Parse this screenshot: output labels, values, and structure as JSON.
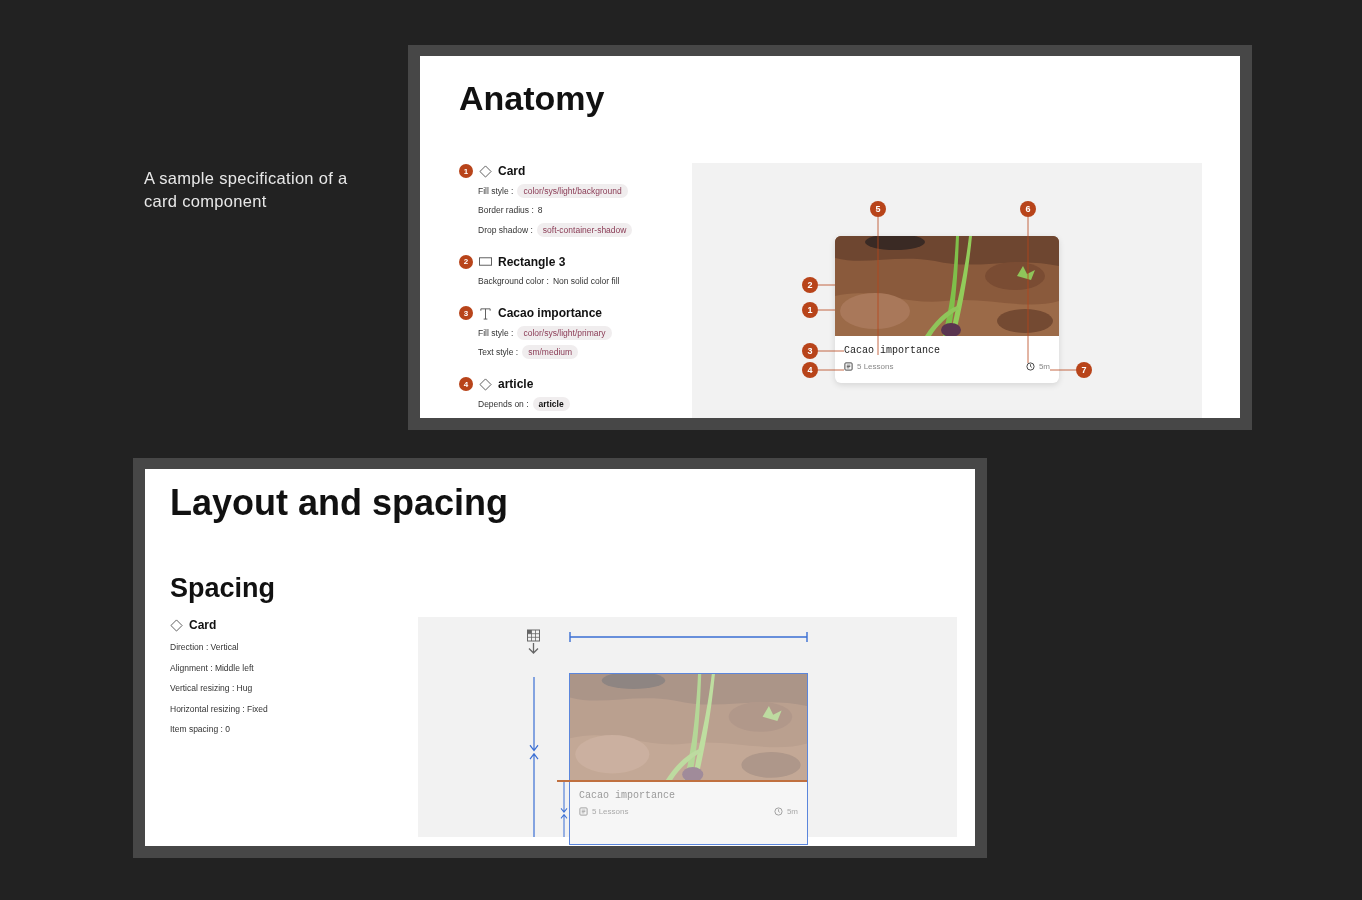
{
  "caption": "A sample specification of a card component",
  "anatomy": {
    "title": "Anatomy",
    "items": [
      {
        "number": "1",
        "kind": "component",
        "name": "Card",
        "properties": [
          {
            "label": "Fill style :",
            "value": "color/sys/light/background",
            "kind": "token"
          },
          {
            "label": "Border radius :",
            "value": "8",
            "kind": "plain"
          },
          {
            "label": "Drop shadow :",
            "value": "soft-container-shadow",
            "kind": "token"
          }
        ]
      },
      {
        "number": "2",
        "kind": "rectangle",
        "name": "Rectangle 3",
        "properties": [
          {
            "label": "Background color :",
            "value": "Non solid color fill",
            "kind": "plain"
          }
        ]
      },
      {
        "number": "3",
        "kind": "text",
        "name": "Cacao importance",
        "properties": [
          {
            "label": "Fill style :",
            "value": "color/sys/light/primary",
            "kind": "token"
          },
          {
            "label": "Text style :",
            "value": "sm/medium",
            "kind": "token"
          }
        ]
      },
      {
        "number": "4",
        "kind": "component",
        "name": "article",
        "properties": [
          {
            "label": "Depends on :",
            "value": "article",
            "kind": "dependency"
          }
        ]
      }
    ],
    "card": {
      "title": "Cacao importance",
      "lessons": "5 Lessons",
      "duration": "5m"
    },
    "markers": [
      "5",
      "6",
      "2",
      "1",
      "3",
      "4",
      "7"
    ]
  },
  "layout": {
    "title": "Layout and spacing",
    "subtitle": "Spacing",
    "component": {
      "kind": "component",
      "name": "Card"
    },
    "properties": [
      {
        "label": "Direction :",
        "value": "Vertical"
      },
      {
        "label": "Alignment :",
        "value": "Middle left"
      },
      {
        "label": "Vertical resizing :",
        "value": "Hug"
      },
      {
        "label": "Horizontal resizing :",
        "value": "Fixed"
      },
      {
        "label": "Item spacing :",
        "value": "0"
      }
    ],
    "card": {
      "title": "Cacao importance",
      "lessons": "5 Lessons",
      "duration": "5m"
    }
  }
}
